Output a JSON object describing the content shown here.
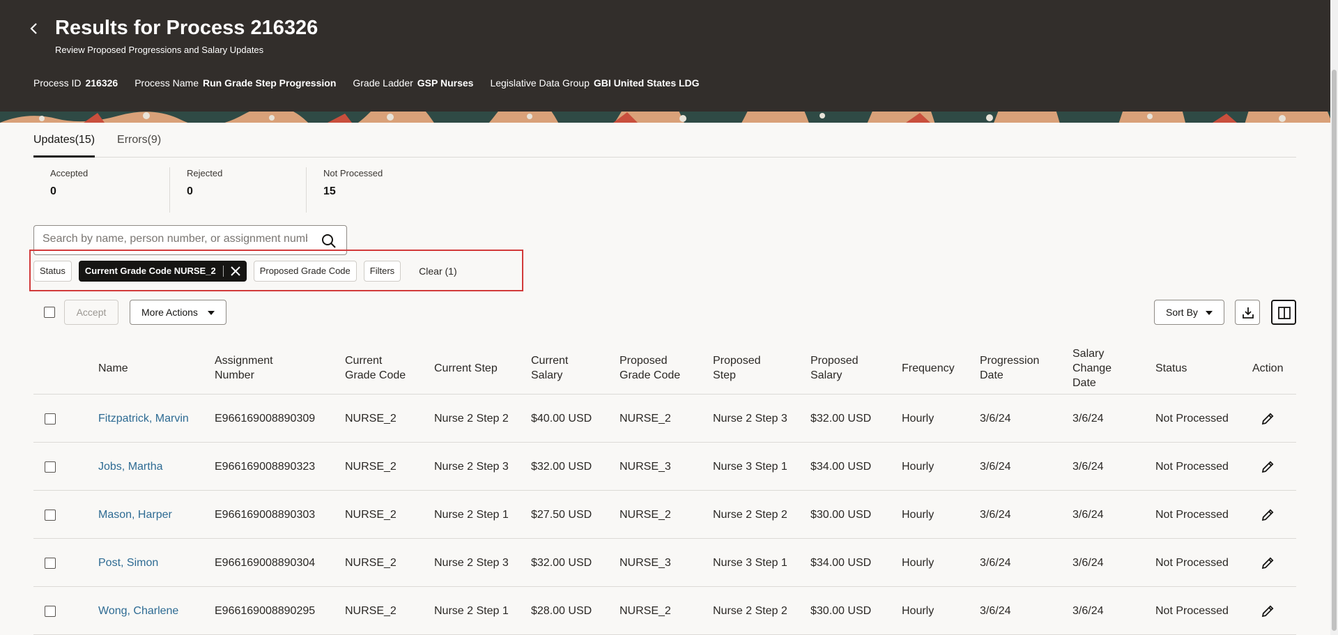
{
  "header": {
    "title": "Results for Process 216326",
    "subtitle": "Review Proposed Progressions and Salary Updates",
    "meta": [
      {
        "label": "Process ID",
        "value": "216326"
      },
      {
        "label": "Process Name",
        "value": "Run Grade Step Progression"
      },
      {
        "label": "Grade Ladder",
        "value": "GSP Nurses"
      },
      {
        "label": "Legislative Data Group",
        "value": "GBI United States LDG"
      }
    ]
  },
  "tabs": [
    {
      "label": "Updates(15)",
      "active": true
    },
    {
      "label": "Errors(9)",
      "active": false
    }
  ],
  "summary": [
    {
      "label": "Accepted",
      "value": "0"
    },
    {
      "label": "Rejected",
      "value": "0"
    },
    {
      "label": "Not Processed",
      "value": "15"
    }
  ],
  "search": {
    "placeholder": "Search by name, person number, or assignment number",
    "value": ""
  },
  "filters": {
    "status": "Status",
    "current_grade": "Current Grade Code NURSE_2",
    "proposed_grade": "Proposed Grade Code",
    "filters": "Filters",
    "clear": "Clear (1)"
  },
  "toolbar": {
    "accept": "Accept",
    "more_actions": "More Actions",
    "sort_by": "Sort By"
  },
  "table": {
    "columns": {
      "name": "Name",
      "assignment_number": "Assignment Number",
      "current_grade": "Current Grade Code",
      "current_step": "Current Step",
      "current_salary": "Current Salary",
      "proposed_grade": "Proposed Grade Code",
      "proposed_step": "Proposed Step",
      "proposed_salary": "Proposed Salary",
      "frequency": "Frequency",
      "progression_date": "Progression Date",
      "salary_change_date": "Salary Change Date",
      "status": "Status",
      "action": "Action"
    },
    "rows": [
      {
        "name": "Fitzpatrick, Marvin",
        "assignment_number": "E966169008890309",
        "current_grade": "NURSE_2",
        "current_step": "Nurse 2 Step 2",
        "current_salary": "$40.00 USD",
        "proposed_grade": "NURSE_2",
        "proposed_step": "Nurse 2 Step 3",
        "proposed_salary": "$32.00 USD",
        "frequency": "Hourly",
        "progression_date": "3/6/24",
        "salary_change_date": "3/6/24",
        "status": "Not Processed"
      },
      {
        "name": "Jobs, Martha",
        "assignment_number": "E966169008890323",
        "current_grade": "NURSE_2",
        "current_step": "Nurse 2 Step 3",
        "current_salary": "$32.00 USD",
        "proposed_grade": "NURSE_3",
        "proposed_step": "Nurse 3 Step 1",
        "proposed_salary": "$34.00 USD",
        "frequency": "Hourly",
        "progression_date": "3/6/24",
        "salary_change_date": "3/6/24",
        "status": "Not Processed"
      },
      {
        "name": "Mason, Harper",
        "assignment_number": "E966169008890303",
        "current_grade": "NURSE_2",
        "current_step": "Nurse 2 Step 1",
        "current_salary": "$27.50 USD",
        "proposed_grade": "NURSE_2",
        "proposed_step": "Nurse 2 Step 2",
        "proposed_salary": "$30.00 USD",
        "frequency": "Hourly",
        "progression_date": "3/6/24",
        "salary_change_date": "3/6/24",
        "status": "Not Processed"
      },
      {
        "name": "Post, Simon",
        "assignment_number": "E966169008890304",
        "current_grade": "NURSE_2",
        "current_step": "Nurse 2 Step 3",
        "current_salary": "$32.00 USD",
        "proposed_grade": "NURSE_3",
        "proposed_step": "Nurse 3 Step 1",
        "proposed_salary": "$34.00 USD",
        "frequency": "Hourly",
        "progression_date": "3/6/24",
        "salary_change_date": "3/6/24",
        "status": "Not Processed"
      },
      {
        "name": "Wong, Charlene",
        "assignment_number": "E966169008890295",
        "current_grade": "NURSE_2",
        "current_step": "Nurse 2 Step 1",
        "current_salary": "$28.00 USD",
        "proposed_grade": "NURSE_2",
        "proposed_step": "Nurse 2 Step 2",
        "proposed_salary": "$30.00 USD",
        "frequency": "Hourly",
        "progression_date": "3/6/24",
        "salary_change_date": "3/6/24",
        "status": "Not Processed"
      }
    ]
  },
  "colors": {
    "header_bg": "#322e2b",
    "link": "#2e6b93",
    "highlight_border": "#d23a3a"
  }
}
